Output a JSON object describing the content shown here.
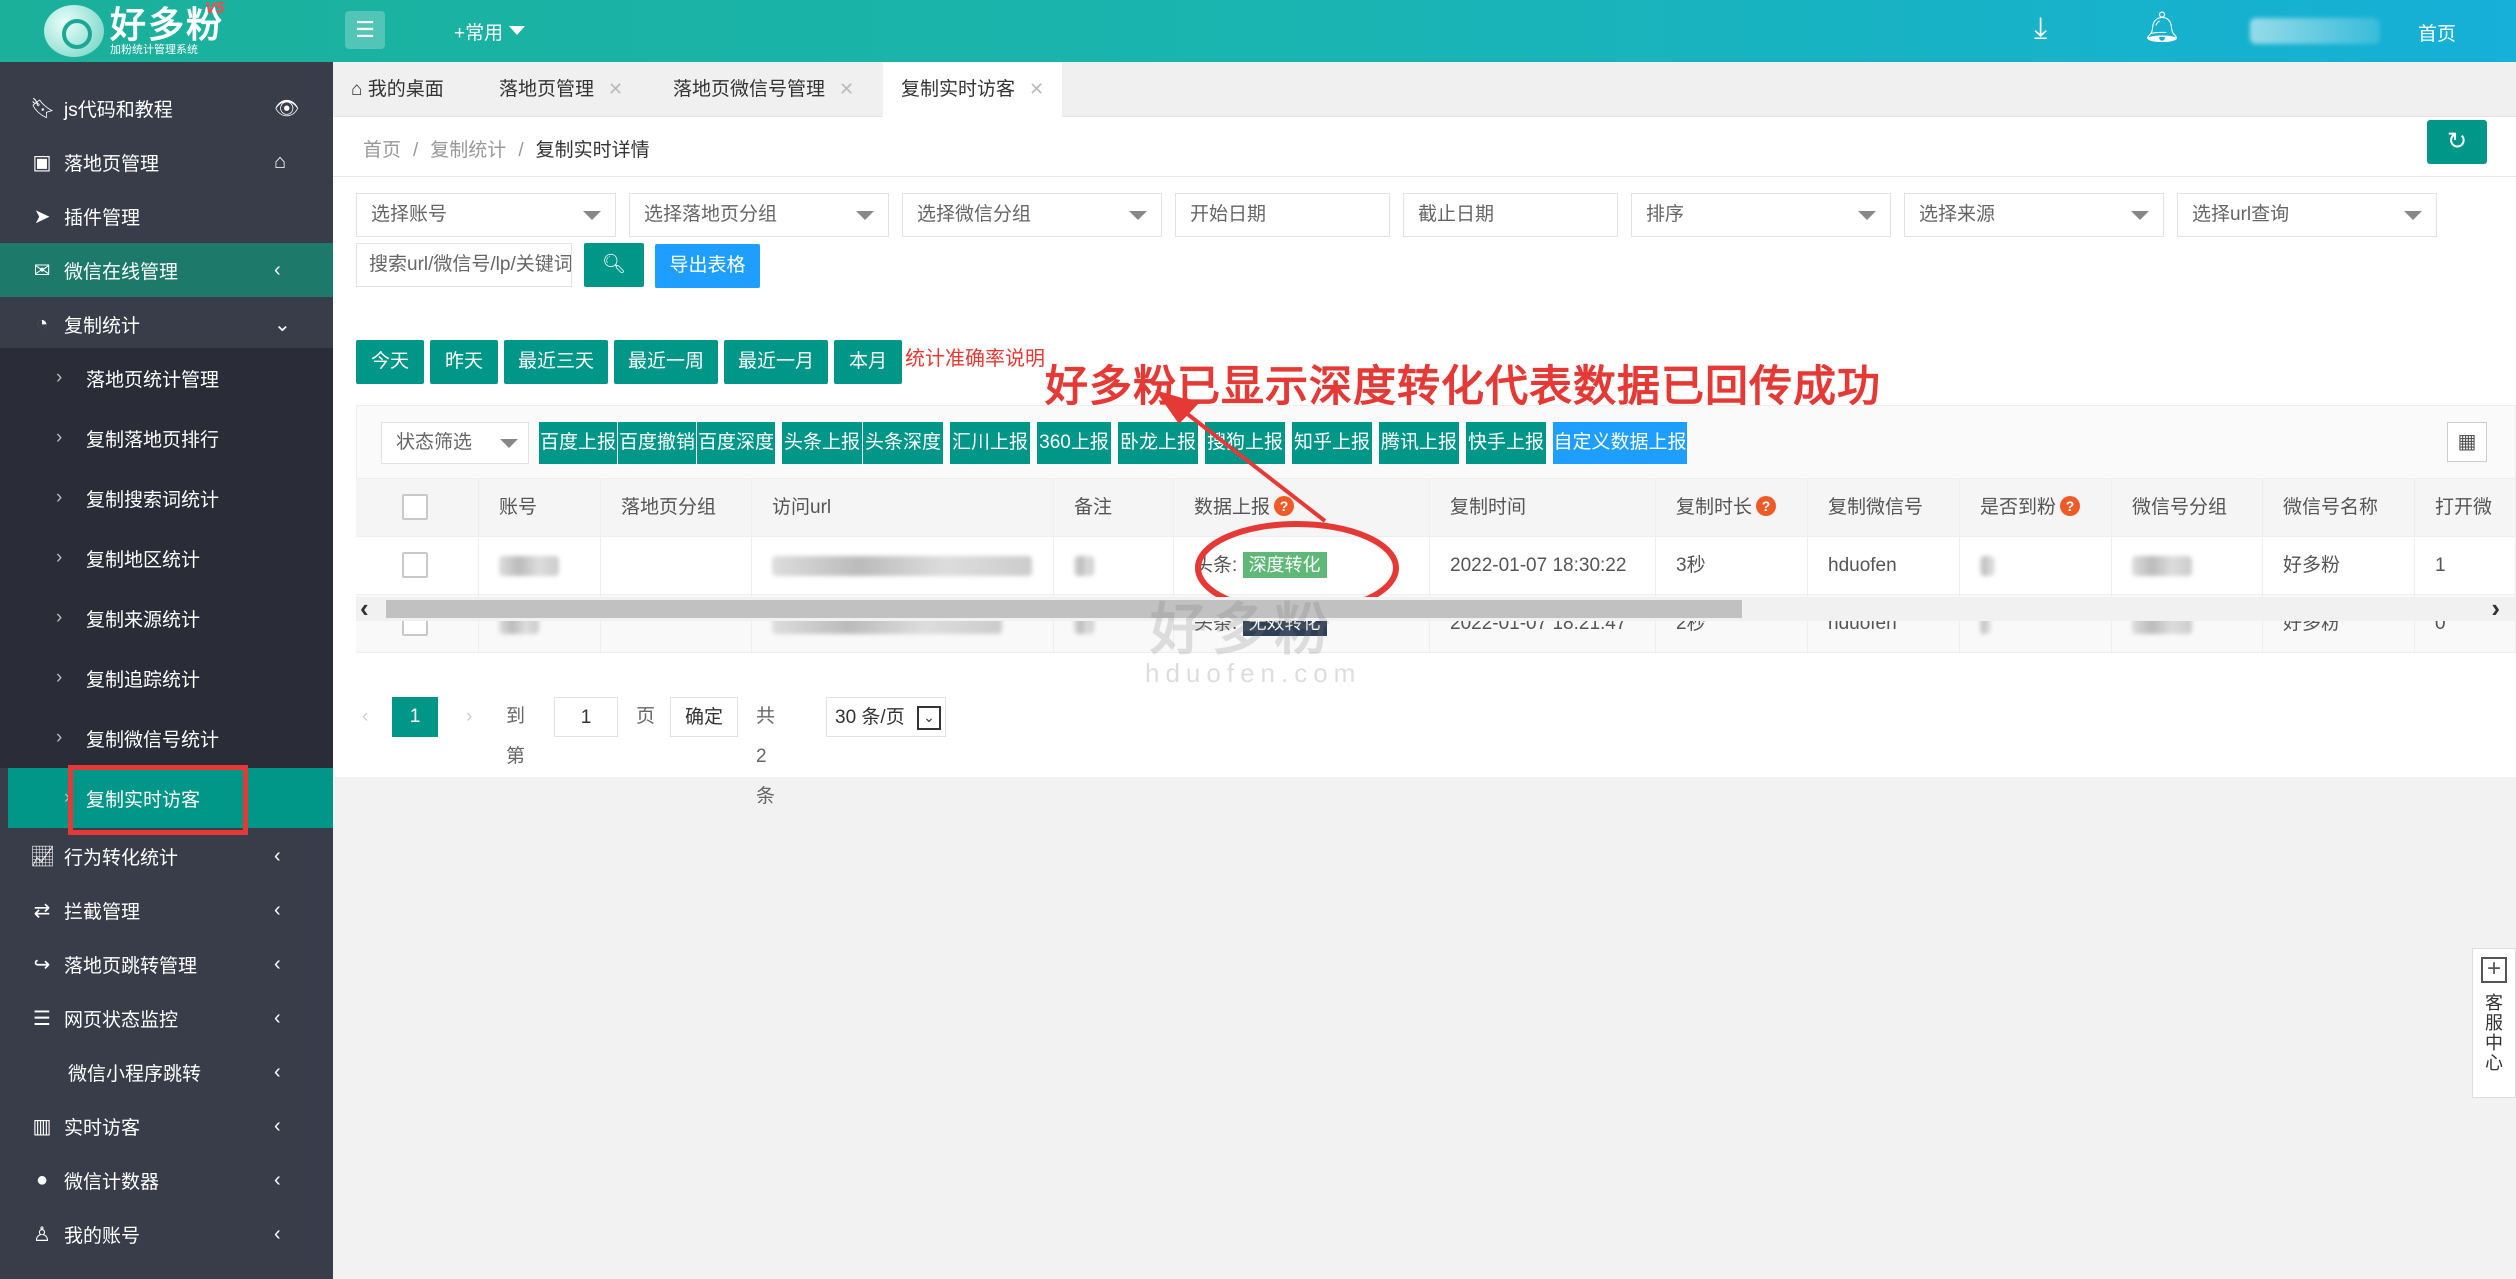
{
  "app": {
    "logo_text": "好多粉",
    "logo_sub": "加粉统计管理系统",
    "version": "V5",
    "menu_icon": "list-icon",
    "common": "+常用",
    "download_icon": "download-icon",
    "bell_icon": "bell-icon",
    "home": "首页"
  },
  "sidebar": {
    "items": [
      {
        "label": "js代码和教程",
        "icon": "bookmark-icon",
        "right": "eye-icon"
      },
      {
        "label": "落地页管理",
        "icon": "page-icon",
        "right": "house-icon"
      },
      {
        "label": "插件管理",
        "icon": "plane-icon"
      },
      {
        "label": "微信在线管理",
        "icon": "wechat-icon",
        "right": "chevron-left-icon"
      },
      {
        "label": "复制统计",
        "icon": "pie-icon",
        "right": "chevron-down-icon"
      }
    ],
    "sub_items": [
      "落地页统计管理",
      "复制落地页排行",
      "复制搜索词统计",
      "复制地区统计",
      "复制来源统计",
      "复制追踪统计",
      "复制微信号统计",
      "复制实时访客"
    ],
    "items_after": [
      {
        "label": "行为转化统计",
        "icon": "chart-line-icon"
      },
      {
        "label": "拦截管理",
        "icon": "swap-icon"
      },
      {
        "label": "落地页跳转管理",
        "icon": "share-icon"
      },
      {
        "label": "网页状态监控",
        "icon": "server-icon"
      },
      {
        "label": "微信小程序跳转",
        "icon": ""
      },
      {
        "label": "实时访客",
        "icon": "bar-chart-icon"
      },
      {
        "label": "微信计数器",
        "icon": "weibo-icon"
      },
      {
        "label": "我的账号",
        "icon": "user-icon"
      }
    ]
  },
  "tabs": {
    "home": "我的桌面",
    "t1": "落地页管理",
    "t2": "落地页微信号管理",
    "t3": "复制实时访客",
    "close": "✕"
  },
  "breadcrumb": {
    "b1": "首页",
    "b2": "复制统计",
    "b3": "复制实时详情",
    "sep": "/"
  },
  "filters": {
    "account": "选择账号",
    "group": "选择落地页分组",
    "wx_group": "选择微信分组",
    "start": "开始日期",
    "end": "截止日期",
    "sort": "排序",
    "source": "选择来源",
    "url": "选择url查询",
    "search": "搜索url/微信号/lp/关键词",
    "export": "导出表格"
  },
  "quick": {
    "today": "今天",
    "yesterday": "昨天",
    "three": "最近三天",
    "week": "最近一周",
    "month": "最近一月",
    "this_month": "本月",
    "note": "统计准确率说明"
  },
  "annotation": "好多粉已显示深度转化代表数据已回传成功",
  "report": {
    "status": "状态筛选",
    "buttons": [
      "百度上报",
      "百度撤销",
      "百度深度",
      "头条上报",
      "头条深度",
      "汇川上报",
      "360上报",
      "卧龙上报",
      "搜狗上报",
      "知乎上报",
      "腾讯上报",
      "快手上报"
    ],
    "custom": "自定义数据上报"
  },
  "table": {
    "headers": [
      "账号",
      "落地页分组",
      "访问url",
      "备注",
      "数据上报",
      "复制时间",
      "复制时长",
      "复制微信号",
      "是否到粉",
      "微信号分组",
      "微信号名称",
      "打开微"
    ],
    "rows": [
      {
        "report_prefix": "头条:",
        "report_tag": "深度转化",
        "time": "2022-01-07 18:30:22",
        "duration": "3秒",
        "wx": "hduofen",
        "name": "好多粉",
        "open": "1"
      },
      {
        "report_prefix": "头条:",
        "report_tag": "无效转化",
        "time": "2022-01-07 18:21:47",
        "duration": "2秒",
        "wx": "hduofen",
        "name": "好多粉",
        "open": "0"
      }
    ]
  },
  "pager": {
    "current": "1",
    "goto": "到第",
    "page_val": "1",
    "page": "页",
    "ok": "确定",
    "total": "共 2 条",
    "size": "30 条/页"
  },
  "watermark": {
    "cn": "好多粉",
    "en": "hduofen.com"
  },
  "service": {
    "label": "客服中心"
  }
}
